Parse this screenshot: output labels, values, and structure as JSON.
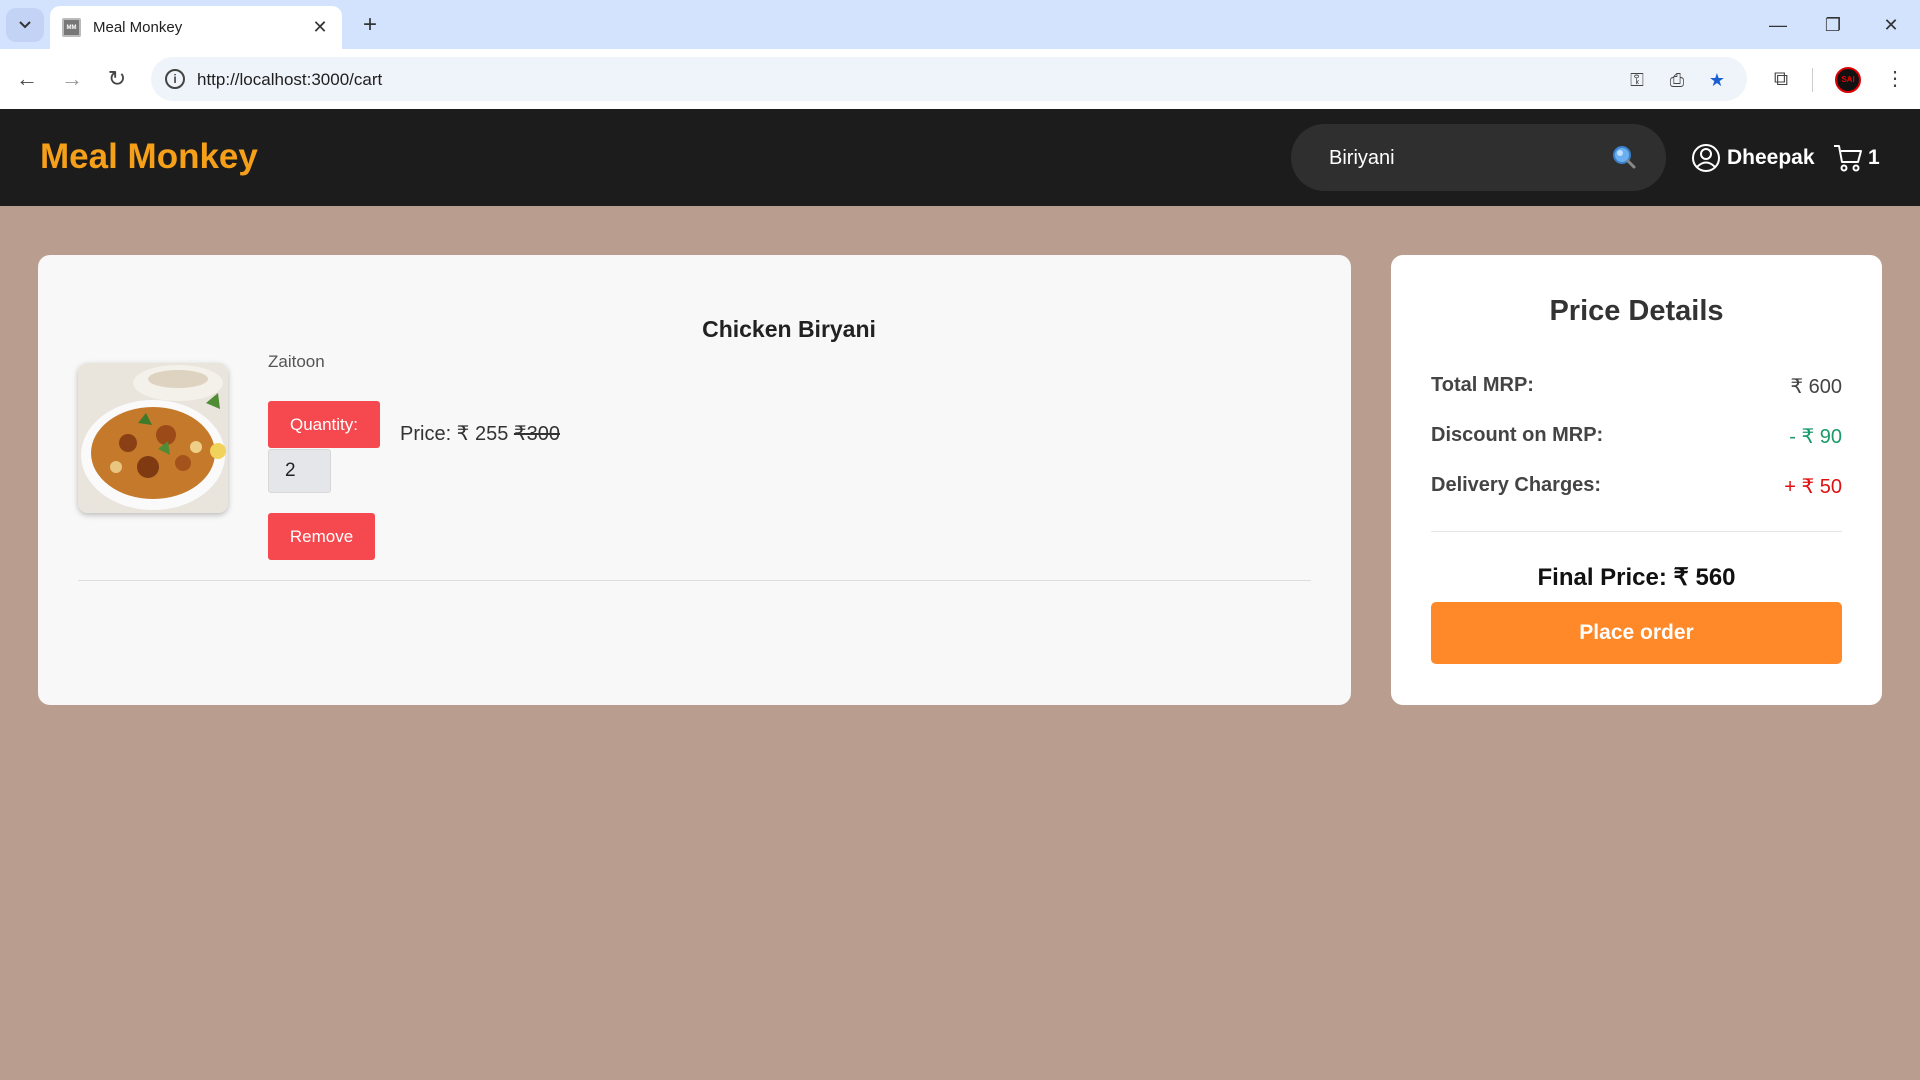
{
  "browser": {
    "tab_title": "Meal Monkey",
    "url": "http://localhost:3000/cart",
    "profile_label": "SAI"
  },
  "header": {
    "logo": "Meal Monkey",
    "search_value": "Biriyani",
    "user_name": "Dheepak",
    "cart_count": "1"
  },
  "cart": {
    "items": [
      {
        "name": "Chicken Biryani",
        "restaurant": "Zaitoon",
        "quantity_label": "Quantity:",
        "quantity": "2",
        "price_label": "Price: ₹ 255",
        "original_price": "₹300",
        "remove_label": "Remove"
      }
    ]
  },
  "price_details": {
    "title": "Price Details",
    "rows": [
      {
        "label": "Total MRP:",
        "value": "₹ 600",
        "color": "#444444"
      },
      {
        "label": "Discount on MRP:",
        "value": "- ₹ 90",
        "color": "#1a9a6a"
      },
      {
        "label": "Delivery Charges:",
        "value": "+ ₹ 50",
        "color": "#e01010"
      }
    ],
    "final_price": "Final Price: ₹ 560",
    "place_order_label": "Place order"
  },
  "colors": {
    "accent": "#f6a01a",
    "button_red": "#f5494f",
    "button_orange": "#ff8828",
    "page_bg": "#b99e90"
  }
}
